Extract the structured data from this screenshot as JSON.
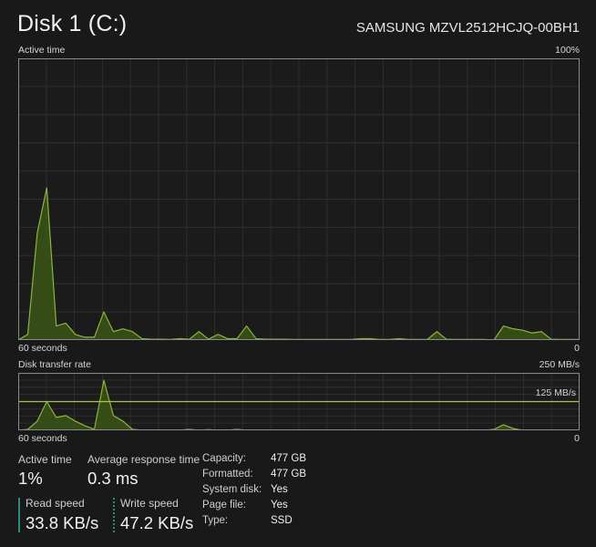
{
  "header": {
    "title": "Disk 1 (C:)",
    "model": "SAMSUNG MZVL2512HCJQ-00BH1"
  },
  "colors": {
    "background": "#191919",
    "grid": "#2f2f2f",
    "border": "#8a8a8a",
    "stroke": "#8cb43c",
    "fill": "#3a5216",
    "reference_line": "#a6c84a",
    "read_indicator": "#2b8a7e"
  },
  "active_chart": {
    "label": "Active time",
    "max_label": "100%",
    "time_label": "60 seconds",
    "min_label": "0"
  },
  "transfer_chart": {
    "label": "Disk transfer rate",
    "max_label": "250 MB/s",
    "ref_label": "125 MB/s",
    "time_label": "60 seconds",
    "min_label": "0"
  },
  "stats": {
    "active_time_label": "Active time",
    "active_time_value": "1%",
    "avg_response_label": "Average response time",
    "avg_response_value": "0.3 ms",
    "read_speed_label": "Read speed",
    "read_speed_value": "33.8 KB/s",
    "write_speed_label": "Write speed",
    "write_speed_value": "47.2 KB/s"
  },
  "properties": [
    {
      "key": "Capacity:",
      "value": "477 GB"
    },
    {
      "key": "Formatted:",
      "value": "477 GB"
    },
    {
      "key": "System disk:",
      "value": "Yes"
    },
    {
      "key": "Page file:",
      "value": "Yes"
    },
    {
      "key": "Type:",
      "value": "SSD"
    }
  ],
  "chart_data": [
    {
      "type": "area",
      "title": "Active time",
      "xlabel": "60 seconds",
      "ylabel": "Active time (%)",
      "ylim": [
        0,
        100
      ],
      "xlim": [
        60,
        0
      ],
      "grid": true,
      "x": [
        60,
        59,
        58,
        57,
        56,
        55,
        54,
        53,
        52,
        51,
        50,
        49,
        48,
        47,
        46,
        45,
        44,
        43,
        42,
        41,
        40,
        39,
        38,
        37,
        36,
        35,
        34,
        33,
        32,
        31,
        30,
        29,
        28,
        27,
        26,
        25,
        24,
        23,
        22,
        21,
        20,
        19,
        18,
        17,
        16,
        15,
        14,
        13,
        12,
        11,
        10,
        9,
        8,
        7,
        6,
        5,
        4,
        3,
        2,
        1
      ],
      "values": [
        0,
        2,
        38,
        54,
        5,
        6,
        2,
        1,
        1,
        10,
        3,
        4,
        3,
        0.5,
        0.3,
        0.3,
        0.2,
        0.5,
        0.3,
        3,
        0.3,
        2,
        0.5,
        0.5,
        5,
        0.5,
        0.3,
        0.3,
        0.3,
        0.2,
        0.2,
        0.2,
        0.2,
        0.2,
        0.2,
        0.2,
        0.5,
        0.5,
        0.2,
        0.2,
        0.5,
        0.2,
        0.2,
        0.2,
        3,
        0.3,
        0.2,
        0.2,
        0.2,
        0.2,
        0,
        5,
        4,
        3.5,
        2.5,
        3,
        0.3,
        0.2,
        0.2,
        0.2
      ]
    },
    {
      "type": "area",
      "title": "Disk transfer rate",
      "xlabel": "60 seconds",
      "ylabel": "MB/s",
      "ylim": [
        0,
        250
      ],
      "xlim": [
        60,
        0
      ],
      "grid": true,
      "reference_line": {
        "value": 125,
        "label": "125 MB/s"
      },
      "x": [
        60,
        59,
        58,
        57,
        56,
        55,
        54,
        53,
        52,
        51,
        50,
        49,
        48,
        47,
        46,
        45,
        44,
        43,
        42,
        41,
        40,
        39,
        38,
        37,
        36,
        35,
        34,
        33,
        32,
        31,
        30,
        29,
        28,
        27,
        26,
        25,
        24,
        23,
        22,
        21,
        20,
        19,
        18,
        17,
        16,
        15,
        14,
        13,
        12,
        11,
        10,
        9,
        8,
        7,
        6,
        5,
        4,
        3,
        2,
        1
      ],
      "values": [
        0,
        4,
        40,
        125,
        56,
        64,
        40,
        20,
        4,
        218,
        64,
        40,
        4,
        0.5,
        0.3,
        0.3,
        0.3,
        0.5,
        4,
        0.3,
        3,
        0.3,
        0.5,
        4,
        0.3,
        0.2,
        0.2,
        0.2,
        0.2,
        0.2,
        0.2,
        0.2,
        0.2,
        0.2,
        0.2,
        0.2,
        0.2,
        0.2,
        0.2,
        0.2,
        0.2,
        0.2,
        0.2,
        0.2,
        0.2,
        0.2,
        0.2,
        0.2,
        0.2,
        0.2,
        4,
        24,
        8,
        0.3,
        0.2,
        0.2,
        0.2,
        0.2,
        0.2,
        0.2
      ]
    }
  ]
}
